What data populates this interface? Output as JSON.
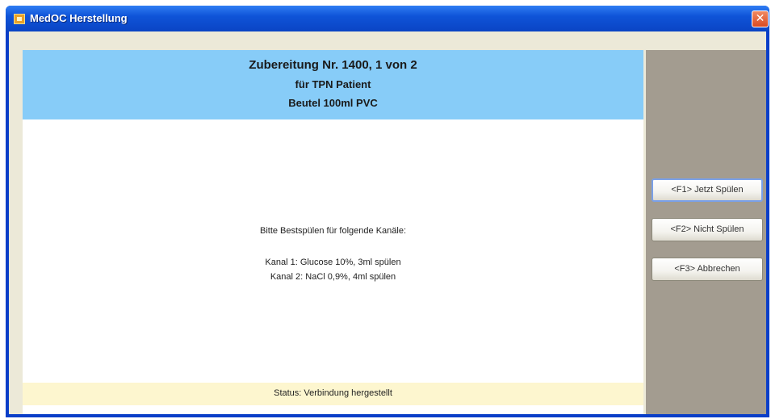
{
  "window": {
    "title": "MedOC Herstellung",
    "close_glyph": "✕"
  },
  "header": {
    "line1": "Zubereitung Nr. 1400, 1 von 2",
    "line2": "für TPN Patient",
    "line3": "Beutel 100ml PVC"
  },
  "message": {
    "intro": "Bitte Bestspülen für folgende Kanäle:",
    "channels": [
      "Kanal 1: Glucose 10%, 3ml spülen",
      "Kanal 2: NaCl 0,9%, 4ml spülen"
    ]
  },
  "status": {
    "text": "Status: Verbindung hergestellt"
  },
  "buttons": [
    {
      "label": "<F1> Jetzt Spülen"
    },
    {
      "label": "<F2> Nicht Spülen"
    },
    {
      "label": "<F3> Abbrechen"
    }
  ],
  "icons": {
    "app": "app-icon",
    "close": "close-icon"
  },
  "colors": {
    "titlebar": "#0f54d8",
    "header": "#87ccf8",
    "status": "#fdf6cf",
    "side_panel": "#a39c90",
    "client": "#ece9d8"
  }
}
